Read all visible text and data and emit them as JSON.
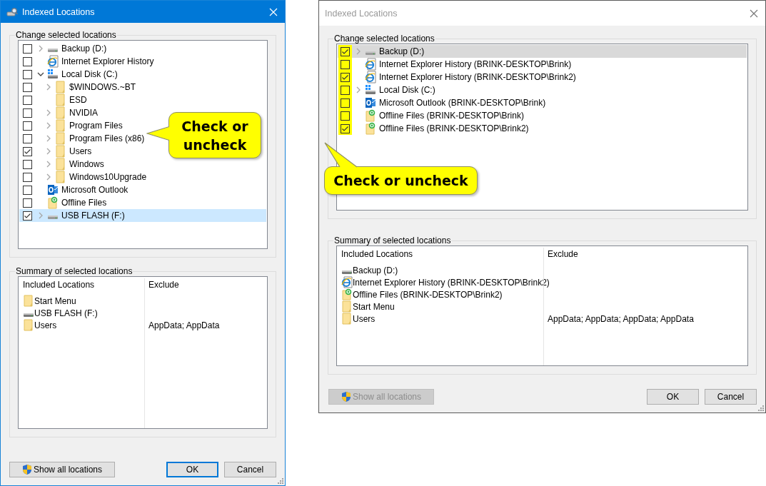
{
  "dialogs": [
    {
      "title": "Indexed Locations",
      "active": true,
      "app_icon": true,
      "tree": {
        "label": "Change selected locations",
        "highlight_checkboxes": false,
        "items": [
          {
            "label": "Backup (D:)",
            "kind": "drive",
            "expandable": true,
            "expanded": false,
            "checked": false,
            "selected": false
          },
          {
            "label": "Internet Explorer History",
            "kind": "ie",
            "expandable": false,
            "checked": false,
            "selected": false
          },
          {
            "label": "Local Disk (C:)",
            "kind": "windrive",
            "expandable": true,
            "expanded": true,
            "checked": false,
            "selected": false,
            "children": [
              {
                "label": "$WINDOWS.~BT",
                "kind": "folder",
                "expandable": true,
                "expanded": false,
                "checked": false,
                "selected": false
              },
              {
                "label": "ESD",
                "kind": "folder",
                "expandable": false,
                "checked": false,
                "selected": false
              },
              {
                "label": "NVIDIA",
                "kind": "folder",
                "expandable": true,
                "expanded": false,
                "checked": false,
                "selected": false
              },
              {
                "label": "Program Files",
                "kind": "folder",
                "expandable": true,
                "expanded": false,
                "checked": false,
                "selected": false
              },
              {
                "label": "Program Files (x86)",
                "kind": "folder",
                "expandable": true,
                "expanded": false,
                "checked": false,
                "selected": false
              },
              {
                "label": "Users",
                "kind": "folder",
                "expandable": true,
                "expanded": false,
                "checked": true,
                "selected": false
              },
              {
                "label": "Windows",
                "kind": "folder",
                "expandable": true,
                "expanded": false,
                "checked": false,
                "selected": false
              },
              {
                "label": "Windows10Upgrade",
                "kind": "folder",
                "expandable": true,
                "expanded": false,
                "checked": false,
                "selected": false
              }
            ]
          },
          {
            "label": "Microsoft Outlook",
            "kind": "outlook",
            "expandable": false,
            "checked": false,
            "selected": false
          },
          {
            "label": "Offline Files",
            "kind": "offline",
            "expandable": false,
            "checked": false,
            "selected": false
          },
          {
            "label": "USB FLASH (F:)",
            "kind": "drive",
            "expandable": true,
            "expanded": false,
            "checked": true,
            "selected": true
          }
        ]
      },
      "summary": {
        "label": "Summary of selected locations",
        "columns": [
          "Included Locations",
          "Exclude"
        ],
        "rows": [
          {
            "kind": "folder",
            "location": "Start Menu"
          },
          {
            "kind": "drive",
            "location": "USB FLASH (F:)"
          },
          {
            "kind": "folder",
            "location": "Users",
            "exclude": "AppData; AppData"
          }
        ]
      },
      "buttons": [
        {
          "label": "Show all locations",
          "kind": "shield",
          "disabled": false,
          "default": false
        },
        {
          "label": "OK",
          "kind": "plain",
          "disabled": false,
          "default": true
        },
        {
          "label": "Cancel",
          "kind": "plain",
          "disabled": false,
          "default": false
        }
      ],
      "callout": {
        "text": "Check or uncheck",
        "kind": "left"
      }
    },
    {
      "title": "Indexed Locations",
      "active": false,
      "app_icon": false,
      "tree": {
        "label": "Change selected locations",
        "highlight_checkboxes": true,
        "items": [
          {
            "label": "Backup (D:)",
            "kind": "drive",
            "expandable": true,
            "expanded": false,
            "checked": true,
            "selected": true
          },
          {
            "label": "Internet Explorer History (BRINK-DESKTOP\\Brink)",
            "kind": "ie",
            "expandable": false,
            "checked": false,
            "selected": false
          },
          {
            "label": "Internet Explorer History (BRINK-DESKTOP\\Brink2)",
            "kind": "ie",
            "expandable": false,
            "checked": true,
            "selected": false
          },
          {
            "label": "Local Disk (C:)",
            "kind": "windrive",
            "expandable": true,
            "expanded": false,
            "checked": false,
            "selected": false
          },
          {
            "label": "Microsoft Outlook (BRINK-DESKTOP\\Brink)",
            "kind": "outlook",
            "expandable": false,
            "checked": false,
            "selected": false
          },
          {
            "label": "Offline Files (BRINK-DESKTOP\\Brink)",
            "kind": "offline",
            "expandable": false,
            "checked": false,
            "selected": false
          },
          {
            "label": "Offline Files (BRINK-DESKTOP\\Brink2)",
            "kind": "offline",
            "expandable": false,
            "checked": true,
            "selected": false
          }
        ]
      },
      "summary": {
        "label": "Summary of selected locations",
        "columns": [
          "Included Locations",
          "Exclude"
        ],
        "rows": [
          {
            "kind": "drive",
            "location": "Backup (D:)"
          },
          {
            "kind": "ie",
            "location": "Internet Explorer History (BRINK-DESKTOP\\Brink2)"
          },
          {
            "kind": "offline",
            "location": "Offline Files (BRINK-DESKTOP\\Brink2)"
          },
          {
            "kind": "folder",
            "location": "Start Menu"
          },
          {
            "kind": "folder",
            "location": "Users",
            "exclude": "AppData; AppData; AppData; AppData"
          }
        ]
      },
      "buttons": [
        {
          "label": "Show all locations",
          "kind": "shield",
          "disabled": true,
          "default": false
        },
        {
          "label": "OK",
          "kind": "plain",
          "disabled": false,
          "default": false
        },
        {
          "label": "Cancel",
          "kind": "plain",
          "disabled": false,
          "default": false
        }
      ],
      "callout": {
        "text": "Check or uncheck",
        "kind": "up"
      }
    }
  ]
}
